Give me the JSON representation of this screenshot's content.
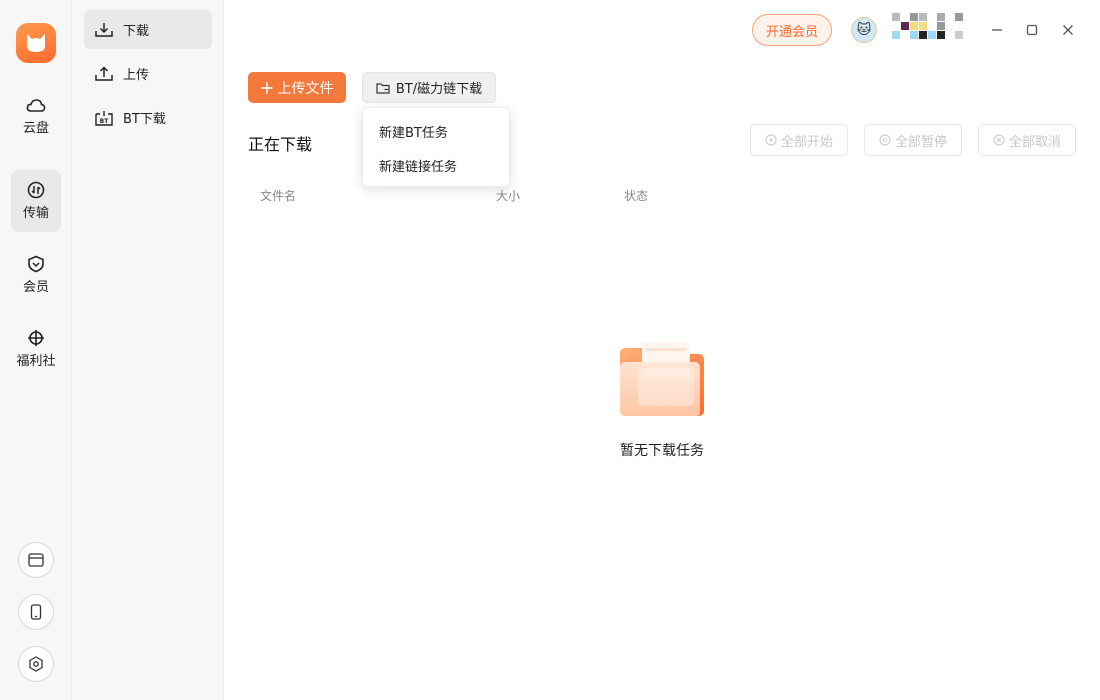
{
  "rail": {
    "items": [
      {
        "label": "云盘",
        "icon": "cloud-icon"
      },
      {
        "label": "传输",
        "icon": "transfer-icon"
      },
      {
        "label": "会员",
        "icon": "vip-shield-icon"
      },
      {
        "label": "福利社",
        "icon": "gift-icon"
      }
    ],
    "bottom_icons": [
      "window-icon",
      "phone-icon",
      "settings-icon"
    ]
  },
  "subnav": {
    "items": [
      {
        "label": "下载",
        "icon": "download-icon"
      },
      {
        "label": "上传",
        "icon": "upload-icon"
      },
      {
        "label": "BT下载",
        "icon": "bt-icon"
      }
    ]
  },
  "header": {
    "vip_label": "开通会员"
  },
  "toolbar": {
    "upload_label": "上传文件",
    "bt_label": "BT/磁力链下载"
  },
  "dropdown": {
    "items": [
      "新建BT任务",
      "新建链接任务"
    ]
  },
  "main": {
    "title": "正在下载",
    "actions": [
      "全部开始",
      "全部暂停",
      "全部取消"
    ],
    "columns": [
      "文件名",
      "大小",
      "状态"
    ],
    "empty_text": "暂无下载任务"
  },
  "colors": {
    "accent": "#f5793d",
    "vip_text": "#f26b2f"
  }
}
